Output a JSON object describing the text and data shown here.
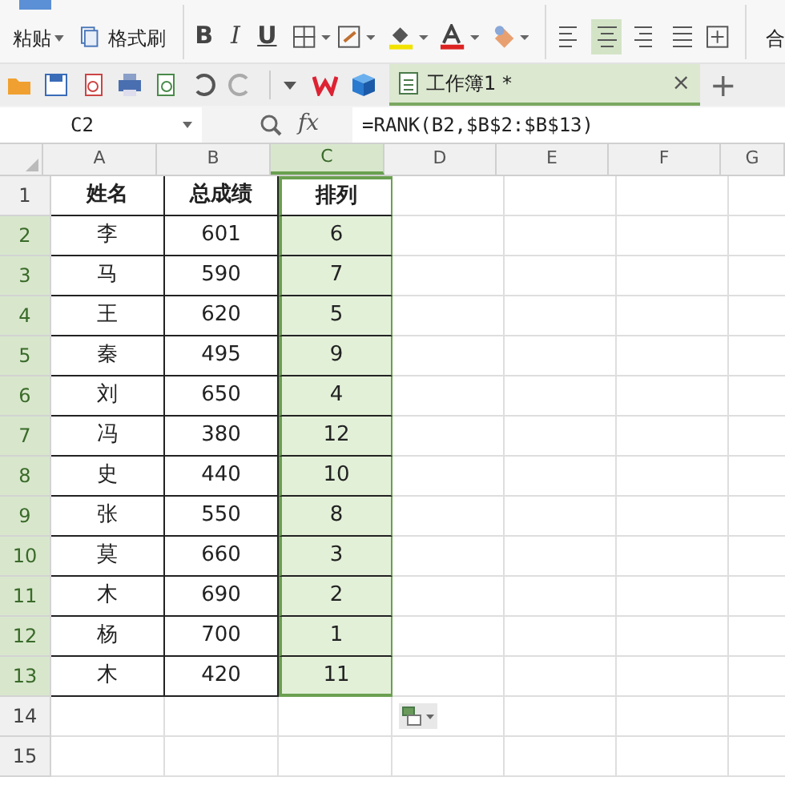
{
  "ribbon": {
    "paste_label": "粘贴",
    "format_painter_label": "格式刷",
    "font_buttons": [
      {
        "label": "B",
        "kind": "bold"
      },
      {
        "label": "I",
        "kind": "italic"
      },
      {
        "label": "U",
        "kind": "underline"
      }
    ],
    "align_buttons": [
      {
        "selected": false
      },
      {
        "selected": true
      },
      {
        "selected": false
      },
      {
        "selected": false
      }
    ],
    "cut_label": "合"
  },
  "tab": {
    "title": "工作簿1 *",
    "close": "×",
    "new_tab": "+"
  },
  "formula_bar": {
    "name_box": "C2",
    "fx": "fx",
    "formula": "=RANK(B2,$B$2:$B$13)"
  },
  "columns": [
    {
      "label": "A",
      "selected": false
    },
    {
      "label": "B",
      "selected": false
    },
    {
      "label": "C",
      "selected": true
    },
    {
      "label": "D",
      "selected": false
    },
    {
      "label": "E",
      "selected": false
    },
    {
      "label": "F",
      "selected": false
    },
    {
      "label": "G",
      "selected": false
    }
  ],
  "rows": [
    {
      "number": "1",
      "selected": false,
      "cells": [
        "姓名",
        "总成绩",
        "排列"
      ]
    },
    {
      "number": "2",
      "selected": true,
      "cells": [
        "李",
        "601",
        "6"
      ]
    },
    {
      "number": "3",
      "selected": true,
      "cells": [
        "马",
        "590",
        "7"
      ]
    },
    {
      "number": "4",
      "selected": true,
      "cells": [
        "王",
        "620",
        "5"
      ]
    },
    {
      "number": "5",
      "selected": true,
      "cells": [
        "秦",
        "495",
        "9"
      ]
    },
    {
      "number": "6",
      "selected": true,
      "cells": [
        "刘",
        "650",
        "4"
      ]
    },
    {
      "number": "7",
      "selected": true,
      "cells": [
        "冯",
        "380",
        "12"
      ]
    },
    {
      "number": "8",
      "selected": true,
      "cells": [
        "史",
        "440",
        "10"
      ]
    },
    {
      "number": "9",
      "selected": true,
      "cells": [
        "张",
        "550",
        "8"
      ]
    },
    {
      "number": "10",
      "selected": true,
      "cells": [
        "莫",
        "660",
        "3"
      ]
    },
    {
      "number": "11",
      "selected": true,
      "cells": [
        "木",
        "690",
        "2"
      ]
    },
    {
      "number": "12",
      "selected": true,
      "cells": [
        "杨",
        "700",
        "1"
      ]
    },
    {
      "number": "13",
      "selected": true,
      "cells": [
        "木",
        "420",
        "11"
      ]
    },
    {
      "number": "14",
      "selected": false,
      "cells": []
    },
    {
      "number": "15",
      "selected": false,
      "cells": []
    }
  ]
}
